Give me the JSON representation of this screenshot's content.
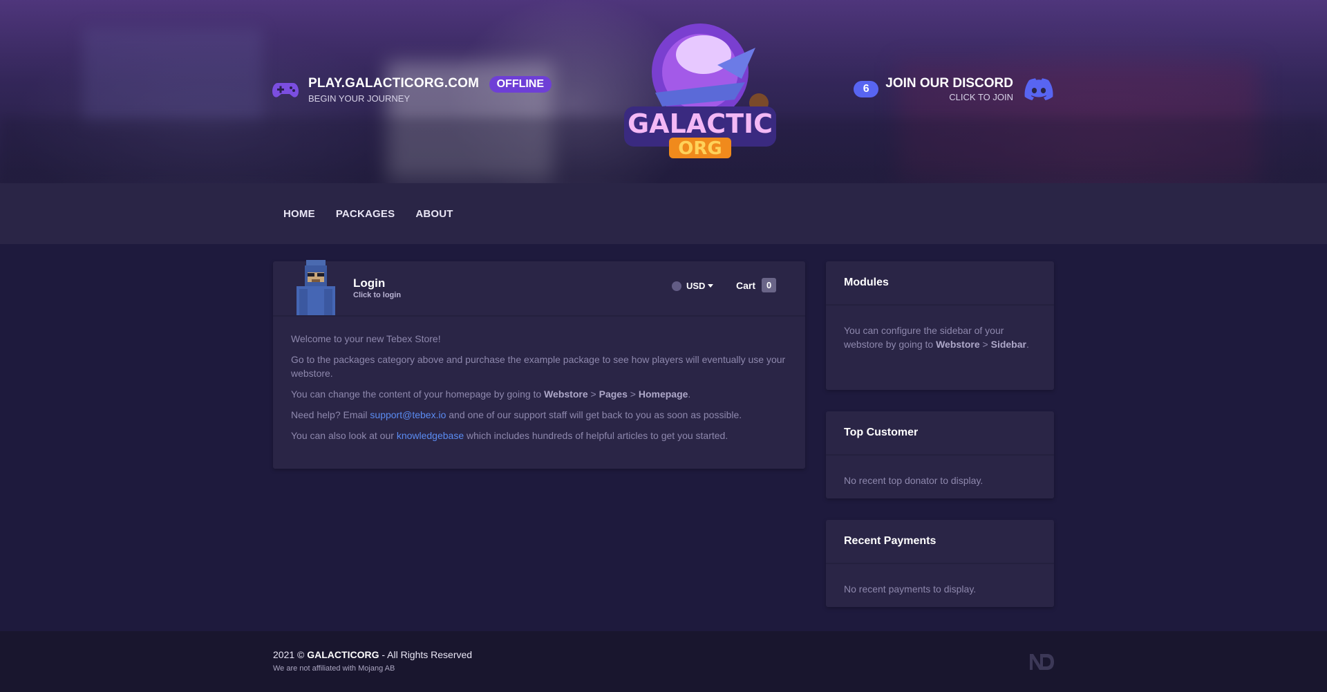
{
  "header": {
    "server_address": "PLAY.GALACTICORG.COM",
    "server_status": "OFFLINE",
    "server_tagline": "BEGIN YOUR JOURNEY",
    "discord_count": "6",
    "discord_title": "JOIN OUR DISCORD",
    "discord_sub": "CLICK TO JOIN",
    "logo_text": "GALACTIC ORG",
    "colors": {
      "status_badge": "#6e3fd6",
      "discord": "#5865f2"
    }
  },
  "nav": {
    "items": [
      {
        "label": "HOME"
      },
      {
        "label": "PACKAGES"
      },
      {
        "label": "ABOUT"
      }
    ]
  },
  "account": {
    "login_title": "Login",
    "login_sub": "Click to login",
    "currency": "USD",
    "cart_label": "Cart",
    "cart_count": "0"
  },
  "welcome": {
    "p1": "Welcome to your new Tebex Store!",
    "p2": "Go to the packages category above and purchase the example package to see how players will eventually use your webstore.",
    "p3_a": "You can change the content of your homepage by going to ",
    "p3_b1": "Webstore",
    "sep": ">",
    "p3_b2": "Pages",
    "p3_b3": "Homepage",
    "p3_end": ".",
    "p4_a": "Need help? Email ",
    "p4_link": "support@tebex.io",
    "p4_b": " and one of our support staff will get back to you as soon as possible.",
    "p5_a": "You can also look at our ",
    "p5_link": "knowledgebase",
    "p5_b": " which includes hundreds of helpful articles to get you started."
  },
  "sidebar": {
    "modules": {
      "title": "Modules",
      "text_a": "You can configure the sidebar of your webstore by going to ",
      "b1": "Webstore",
      "sep": ">",
      "b2": "Sidebar",
      "end": "."
    },
    "top_customer": {
      "title": "Top Customer",
      "text": "No recent top donator to display."
    },
    "recent_payments": {
      "title": "Recent Payments",
      "text": "No recent payments to display."
    }
  },
  "footer": {
    "year_prefix": "2021 ©",
    "brand": "GALACTICORG",
    "rights": "- All Rights Reserved",
    "disclaimer": "We are not affiliated with Mojang AB"
  }
}
